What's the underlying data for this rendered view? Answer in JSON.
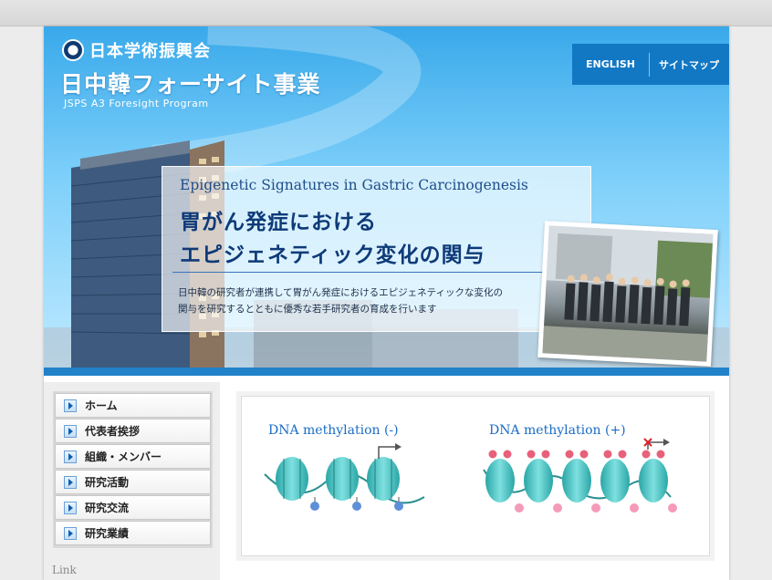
{
  "header": {
    "org_name": "日本学術振興会",
    "site_title": "日中韓フォーサイト事業",
    "site_subtitle": "JSPS A3 Foresight Program",
    "nav": [
      "ENGLISH",
      "サイトマップ"
    ]
  },
  "hero": {
    "title_en": "Epigenetic Signatures in Gastric Carcinogenesis",
    "title_jp_line1": "胃がん発症における",
    "title_jp_line2": "エピジェネティック変化の関与",
    "description_line1": "日中韓の研究者が連携して胃がん発症におけるエピジェネティックな変化の",
    "description_line2": "関与を研究するとともに優秀な若手研究者の育成を行います"
  },
  "sidebar": {
    "menu": [
      {
        "label": "ホーム"
      },
      {
        "label": "代表者挨拶"
      },
      {
        "label": "組織・メンバー"
      },
      {
        "label": "研究活動"
      },
      {
        "label": "研究交流"
      },
      {
        "label": "研究業績"
      }
    ],
    "link_heading": "Link"
  },
  "main": {
    "figure_left_label": "DNA methylation (-)",
    "figure_right_label": "DNA methylation (+)"
  },
  "colors": {
    "hero_blue": "#39a9ea",
    "nav_blue": "#1278c4",
    "title_navy": "#0e3a78",
    "nucleosome": "#4fc8c8",
    "methyl_red": "#e8607a",
    "unmethyl_blue": "#5f8fd8"
  }
}
